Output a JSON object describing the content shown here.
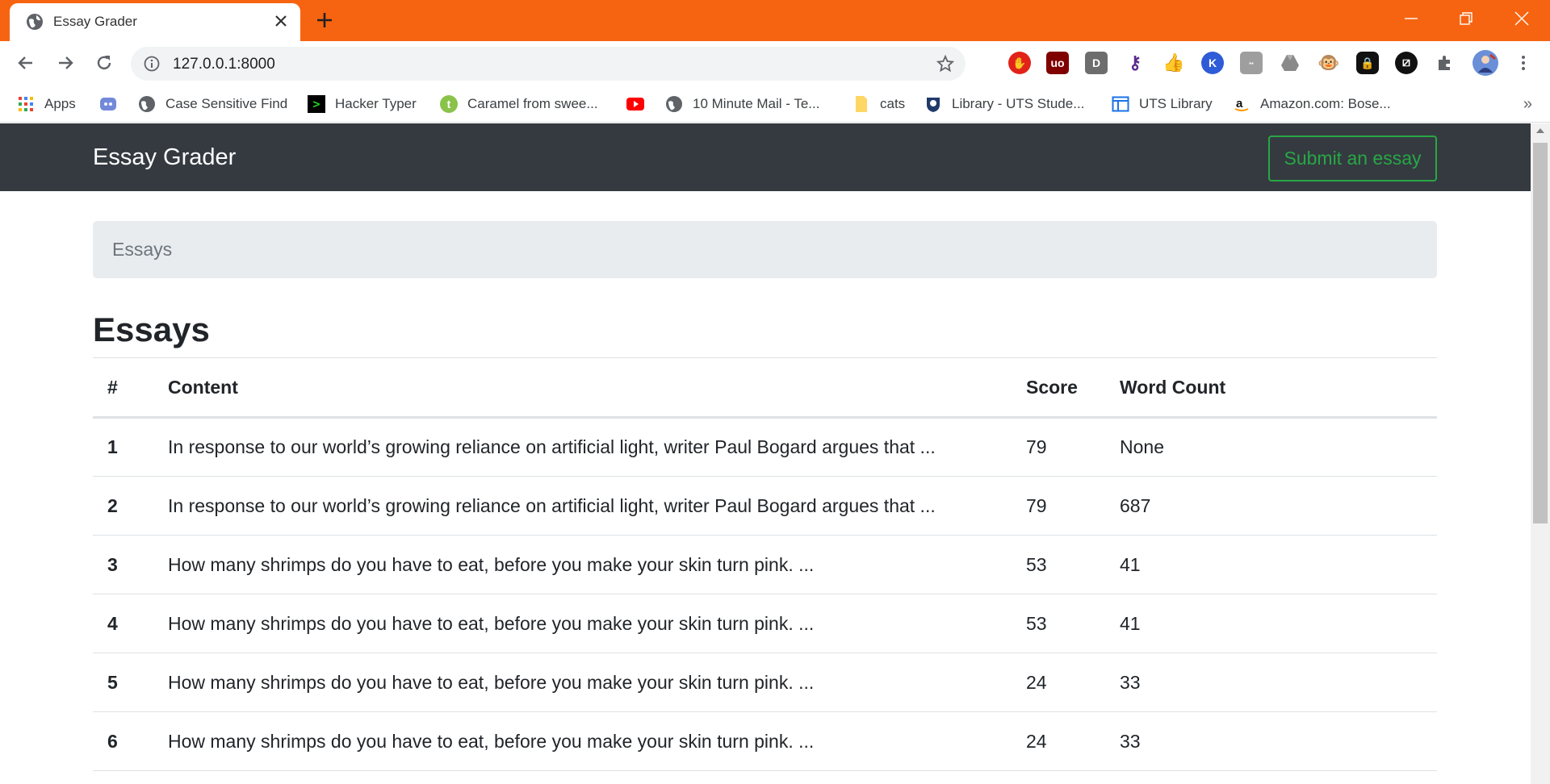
{
  "browser": {
    "tab_title": "Essay Grader",
    "url": "127.0.0.1:8000",
    "bookmarks": [
      {
        "label": "Apps",
        "icon": "apps-grid-icon"
      },
      {
        "label": "",
        "icon": "discord-icon"
      },
      {
        "label": "Case Sensitive Find",
        "icon": "globe-icon"
      },
      {
        "label": "Hacker Typer",
        "icon": "terminal-icon"
      },
      {
        "label": "Caramel from swee...",
        "icon": "t-green-icon"
      },
      {
        "label": "",
        "icon": "youtube-icon"
      },
      {
        "label": "10 Minute Mail - Te...",
        "icon": "globe-icon"
      },
      {
        "label": "cats",
        "icon": "folder-icon"
      },
      {
        "label": "Library - UTS Stude...",
        "icon": "crest-icon"
      },
      {
        "label": "UTS Library",
        "icon": "layout-icon"
      },
      {
        "label": "Amazon.com: Bose...",
        "icon": "amazon-icon"
      }
    ],
    "colors": {
      "tab_strip": "#f76411"
    }
  },
  "navbar": {
    "brand": "Essay Grader",
    "submit_label": "Submit an essay"
  },
  "breadcrumb": {
    "label": "Essays"
  },
  "page_title": "Essays",
  "table": {
    "headers": [
      "#",
      "Content",
      "Score",
      "Word Count"
    ],
    "rows": [
      {
        "num": "1",
        "content": "In response to our world’s growing reliance on artificial light, writer Paul Bogard argues that ...",
        "score": "79",
        "word_count": "None"
      },
      {
        "num": "2",
        "content": "In response to our world’s growing reliance on artificial light, writer Paul Bogard argues that ...",
        "score": "79",
        "word_count": "687"
      },
      {
        "num": "3",
        "content": "How many shrimps do you have to eat, before you make your skin turn pink. ...",
        "score": "53",
        "word_count": "41"
      },
      {
        "num": "4",
        "content": "How many shrimps do you have to eat, before you make your skin turn pink. ...",
        "score": "53",
        "word_count": "41"
      },
      {
        "num": "5",
        "content": "How many shrimps do you have to eat, before you make your skin turn pink. ...",
        "score": "24",
        "word_count": "33"
      },
      {
        "num": "6",
        "content": "How many shrimps do you have to eat, before you make your skin turn pink. ...",
        "score": "24",
        "word_count": "33"
      }
    ]
  }
}
